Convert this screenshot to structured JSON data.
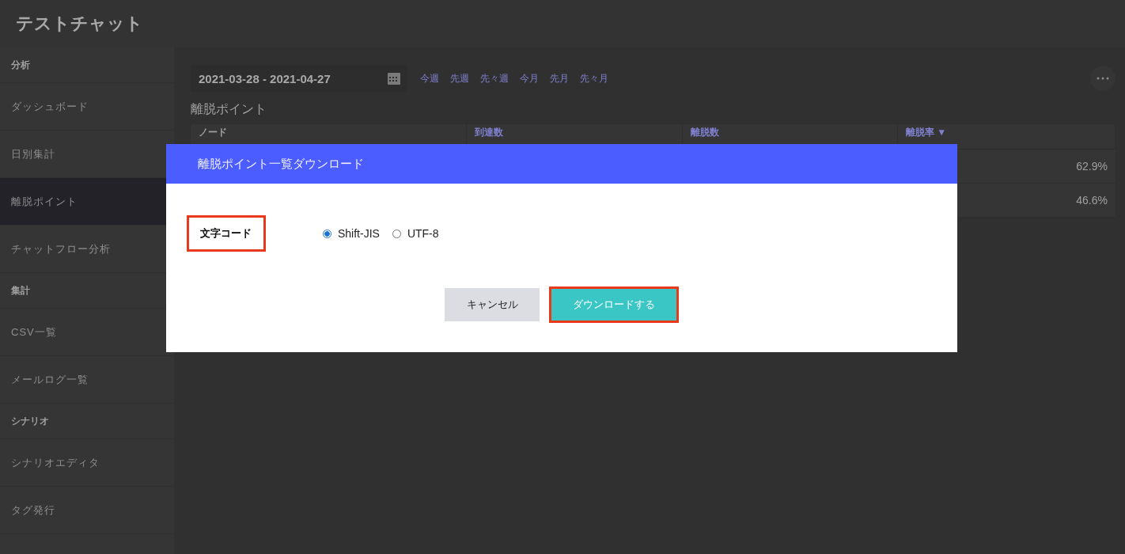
{
  "header": {
    "title": "テストチャット"
  },
  "sidebar": {
    "sections": [
      {
        "heading": "分析",
        "items": [
          {
            "label": "ダッシュボード",
            "selected": false
          },
          {
            "label": "日別集計",
            "selected": false
          },
          {
            "label": "離脱ポイント",
            "selected": true
          },
          {
            "label": "チャットフロー分析",
            "selected": false
          }
        ]
      },
      {
        "heading": "集計",
        "items": [
          {
            "label": "CSV一覧",
            "selected": false
          },
          {
            "label": "メールログ一覧",
            "selected": false
          }
        ]
      },
      {
        "heading": "シナリオ",
        "items": [
          {
            "label": "シナリオエディタ",
            "selected": false
          },
          {
            "label": "タグ発行",
            "selected": false
          }
        ]
      }
    ]
  },
  "date_range": {
    "value": "2021-03-28 - 2021-04-27"
  },
  "quick_ranges": [
    "今週",
    "先週",
    "先々週",
    "今月",
    "先月",
    "先々月"
  ],
  "page_title": "離脱ポイント",
  "table": {
    "columns": [
      "ノード",
      "到達数",
      "離脱数",
      "離脱率 ▼"
    ],
    "rows": [
      {
        "rate": "62.9%"
      },
      {
        "rate": "46.6%"
      }
    ]
  },
  "dialog": {
    "title": "離脱ポイント一覧ダウンロード",
    "field_label": "文字コード",
    "label_highlighted": true,
    "options": [
      {
        "label": "Shift-JIS",
        "selected": true
      },
      {
        "label": "UTF-8",
        "selected": false
      }
    ],
    "buttons": [
      {
        "label": "キャンセル",
        "kind": "secondary",
        "highlighted": false
      },
      {
        "label": "ダウンロードする",
        "kind": "primary",
        "highlighted": true
      }
    ]
  }
}
